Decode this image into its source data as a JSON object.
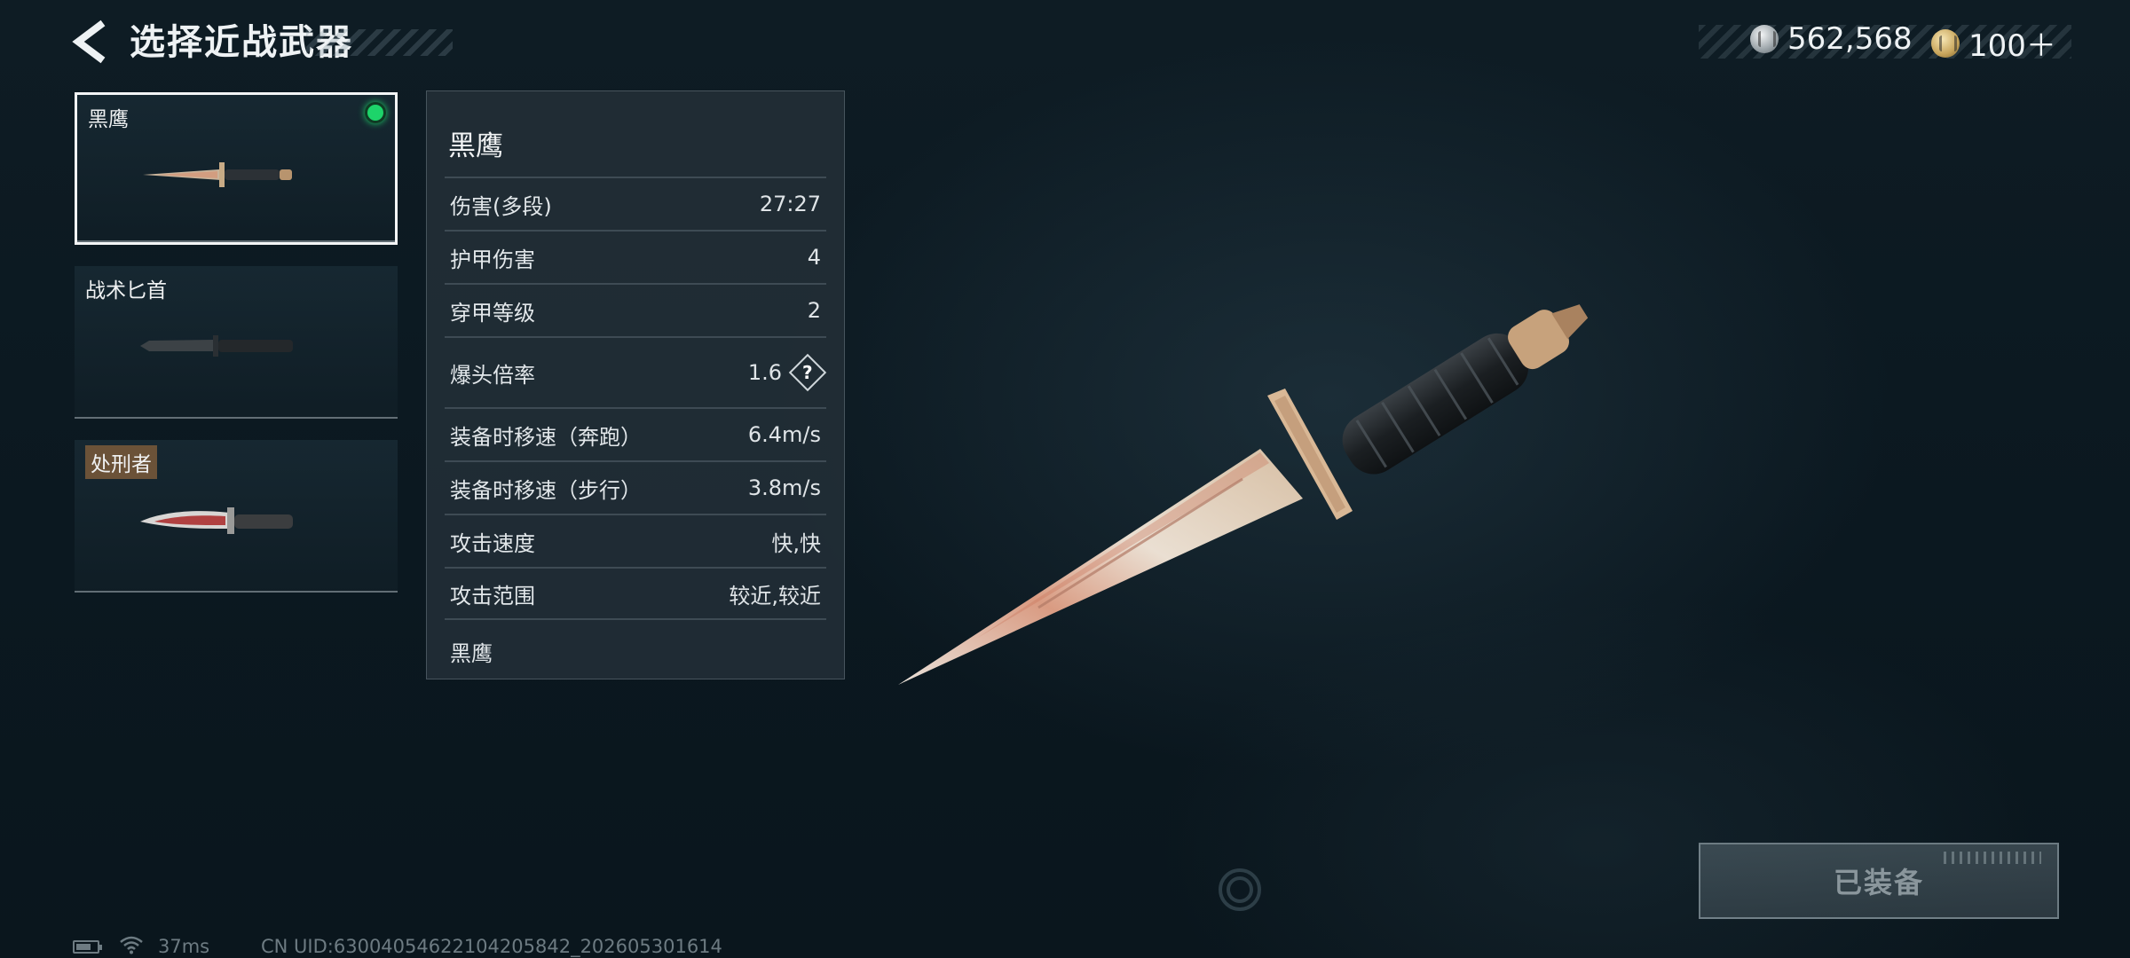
{
  "header": {
    "title": "选择近战武器",
    "currency": [
      {
        "icon": "silver-coin-icon",
        "amount": "562,568"
      },
      {
        "icon": "gold-coin-icon",
        "amount": "100＋"
      }
    ]
  },
  "weapons": [
    {
      "name": "黑鹰",
      "selected": true,
      "equipped": true
    },
    {
      "name": "战术匕首",
      "selected": false,
      "equipped": false
    },
    {
      "name": "处刑者",
      "selected": false,
      "equipped": false
    }
  ],
  "stats": {
    "title": "黑鹰",
    "rows": [
      {
        "label": "伤害(多段)",
        "value": "27:27"
      },
      {
        "label": "护甲伤害",
        "value": "4"
      },
      {
        "label": "穿甲等级",
        "value": "2"
      },
      {
        "label": "爆头倍率",
        "value": "1.6"
      },
      {
        "label": "装备时移速（奔跑）",
        "value": "6.4m/s"
      },
      {
        "label": "装备时移速（步行）",
        "value": "3.8m/s"
      },
      {
        "label": "攻击速度",
        "value": "快,快"
      },
      {
        "label": "攻击范围",
        "value": "较近,较近"
      }
    ],
    "footer": "黑鹰",
    "help_label": "?"
  },
  "equip_button": {
    "label": "已装备"
  },
  "status_bar": {
    "ping": "37ms",
    "uid": "CN UID:63004054622104205842_202605301614"
  },
  "colors": {
    "equipped_dot": "#1dd46a",
    "tag_bg": "#6b5238"
  }
}
